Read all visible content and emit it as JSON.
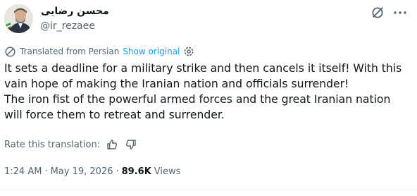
{
  "author": {
    "display_name": "محسن رضایی",
    "handle": "@ir_rezaee"
  },
  "translation": {
    "label": "Translated from Persian",
    "show_original": "Show original",
    "rate_prompt": "Rate this translation:"
  },
  "tweet": {
    "lines": [
      "It sets a deadline for a military strike and then cancels it itself! With this",
      "vain hope of making the Iranian nation and officials surrender!",
      "The iron fist of the powerful armed forces and the great Iranian nation",
      "will force them to retreat and surrender."
    ]
  },
  "meta": {
    "time": "1:24 AM",
    "separator": "·",
    "date": "May 19, 2026",
    "views_count": "89.6K",
    "views_label": "Views"
  },
  "icons": {
    "grok": "grok-icon",
    "more": "more-icon",
    "translate": "translate-icon",
    "settings": "settings-icon",
    "thumbs_up": "thumbs-up-icon",
    "thumbs_down": "thumbs-down-icon"
  },
  "colors": {
    "text": "#0f1419",
    "secondary": "#536471",
    "link": "#1d9bf0"
  }
}
